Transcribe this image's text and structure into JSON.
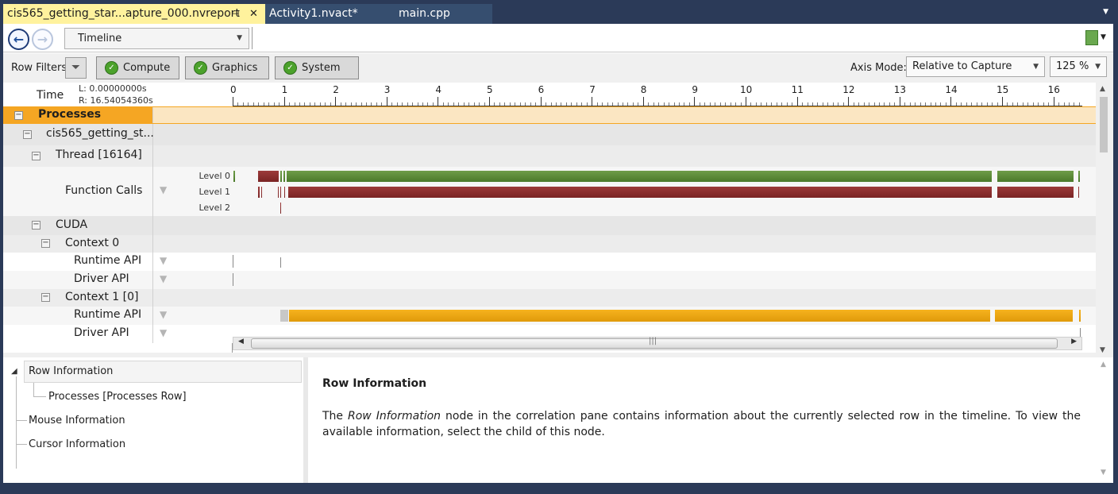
{
  "tabs": [
    {
      "label": "cis565_getting_star...apture_000.nvreport",
      "active": true
    },
    {
      "label": "Activity1.nvact*"
    },
    {
      "label": "main.cpp"
    }
  ],
  "toolbar": {
    "view_select": "Timeline"
  },
  "filters": {
    "label": "Row Filters",
    "buttons": [
      "Compute",
      "Graphics",
      "System"
    ],
    "axis_mode_label": "Axis Mode:",
    "axis_mode_value": "Relative to Capture",
    "zoom_value": "125 %"
  },
  "timeline": {
    "time_label": "Time",
    "left_time": "L: 0.00000000s",
    "right_time": "R: 16.54054360s",
    "ticks": [
      "0",
      "1",
      "2",
      "3",
      "4",
      "5",
      "6",
      "7",
      "8",
      "9",
      "10",
      "11",
      "12",
      "13",
      "14",
      "15",
      "16"
    ],
    "rows": {
      "processes": "Processes",
      "process": "cis565_getting_st...",
      "thread": "Thread [16164]",
      "function_calls": "Function Calls",
      "level0": "Level 0",
      "level1": "Level 1",
      "level2": "Level 2",
      "cuda": "CUDA",
      "context0": "Context 0",
      "runtime_api_0": "Runtime API",
      "driver_api_0": "Driver API",
      "context1": "Context 1 [0]",
      "runtime_api_1": "Runtime API",
      "driver_api_1": "Driver API"
    },
    "colors": {
      "level0": "#5a8a38",
      "level1": "#8b2e2e",
      "runtime": "#f0a814",
      "selected_row": "#f5a623"
    }
  },
  "chart_data": {
    "type": "timeline",
    "x_unit": "s",
    "xlim": [
      0,
      16.54
    ],
    "series": [
      {
        "name": "Level 0",
        "segments": [
          [
            0.02,
            0.04
          ],
          [
            0.5,
            0.55
          ],
          [
            0.55,
            0.9
          ],
          [
            0.93,
            0.96
          ],
          [
            0.99,
            1.02
          ],
          [
            1.06,
            14.8
          ],
          [
            14.9,
            16.4
          ],
          [
            16.48,
            16.52
          ]
        ]
      },
      {
        "name": "Level 1",
        "segments": [
          [
            0.5,
            0.52
          ],
          [
            0.55,
            0.57
          ],
          [
            0.88,
            0.9
          ],
          [
            0.93,
            0.95
          ],
          [
            1.0,
            1.02
          ],
          [
            1.08,
            14.8
          ],
          [
            14.9,
            16.4
          ],
          [
            16.48,
            16.5
          ]
        ]
      },
      {
        "name": "Level 2",
        "segments": [
          [
            0.93,
            0.95
          ]
        ]
      }
    ]
  },
  "info": {
    "tree_root": "Row Information",
    "tree_child": "Processes [Processes Row]",
    "tree_mouse": "Mouse Information",
    "tree_cursor": "Cursor Information",
    "title": "Row Information",
    "body_pre": "The ",
    "body_em": "Row Information",
    "body_post": " node in the correlation pane contains information about the currently selected row in the timeline. To view the available information, select the child of this node."
  }
}
